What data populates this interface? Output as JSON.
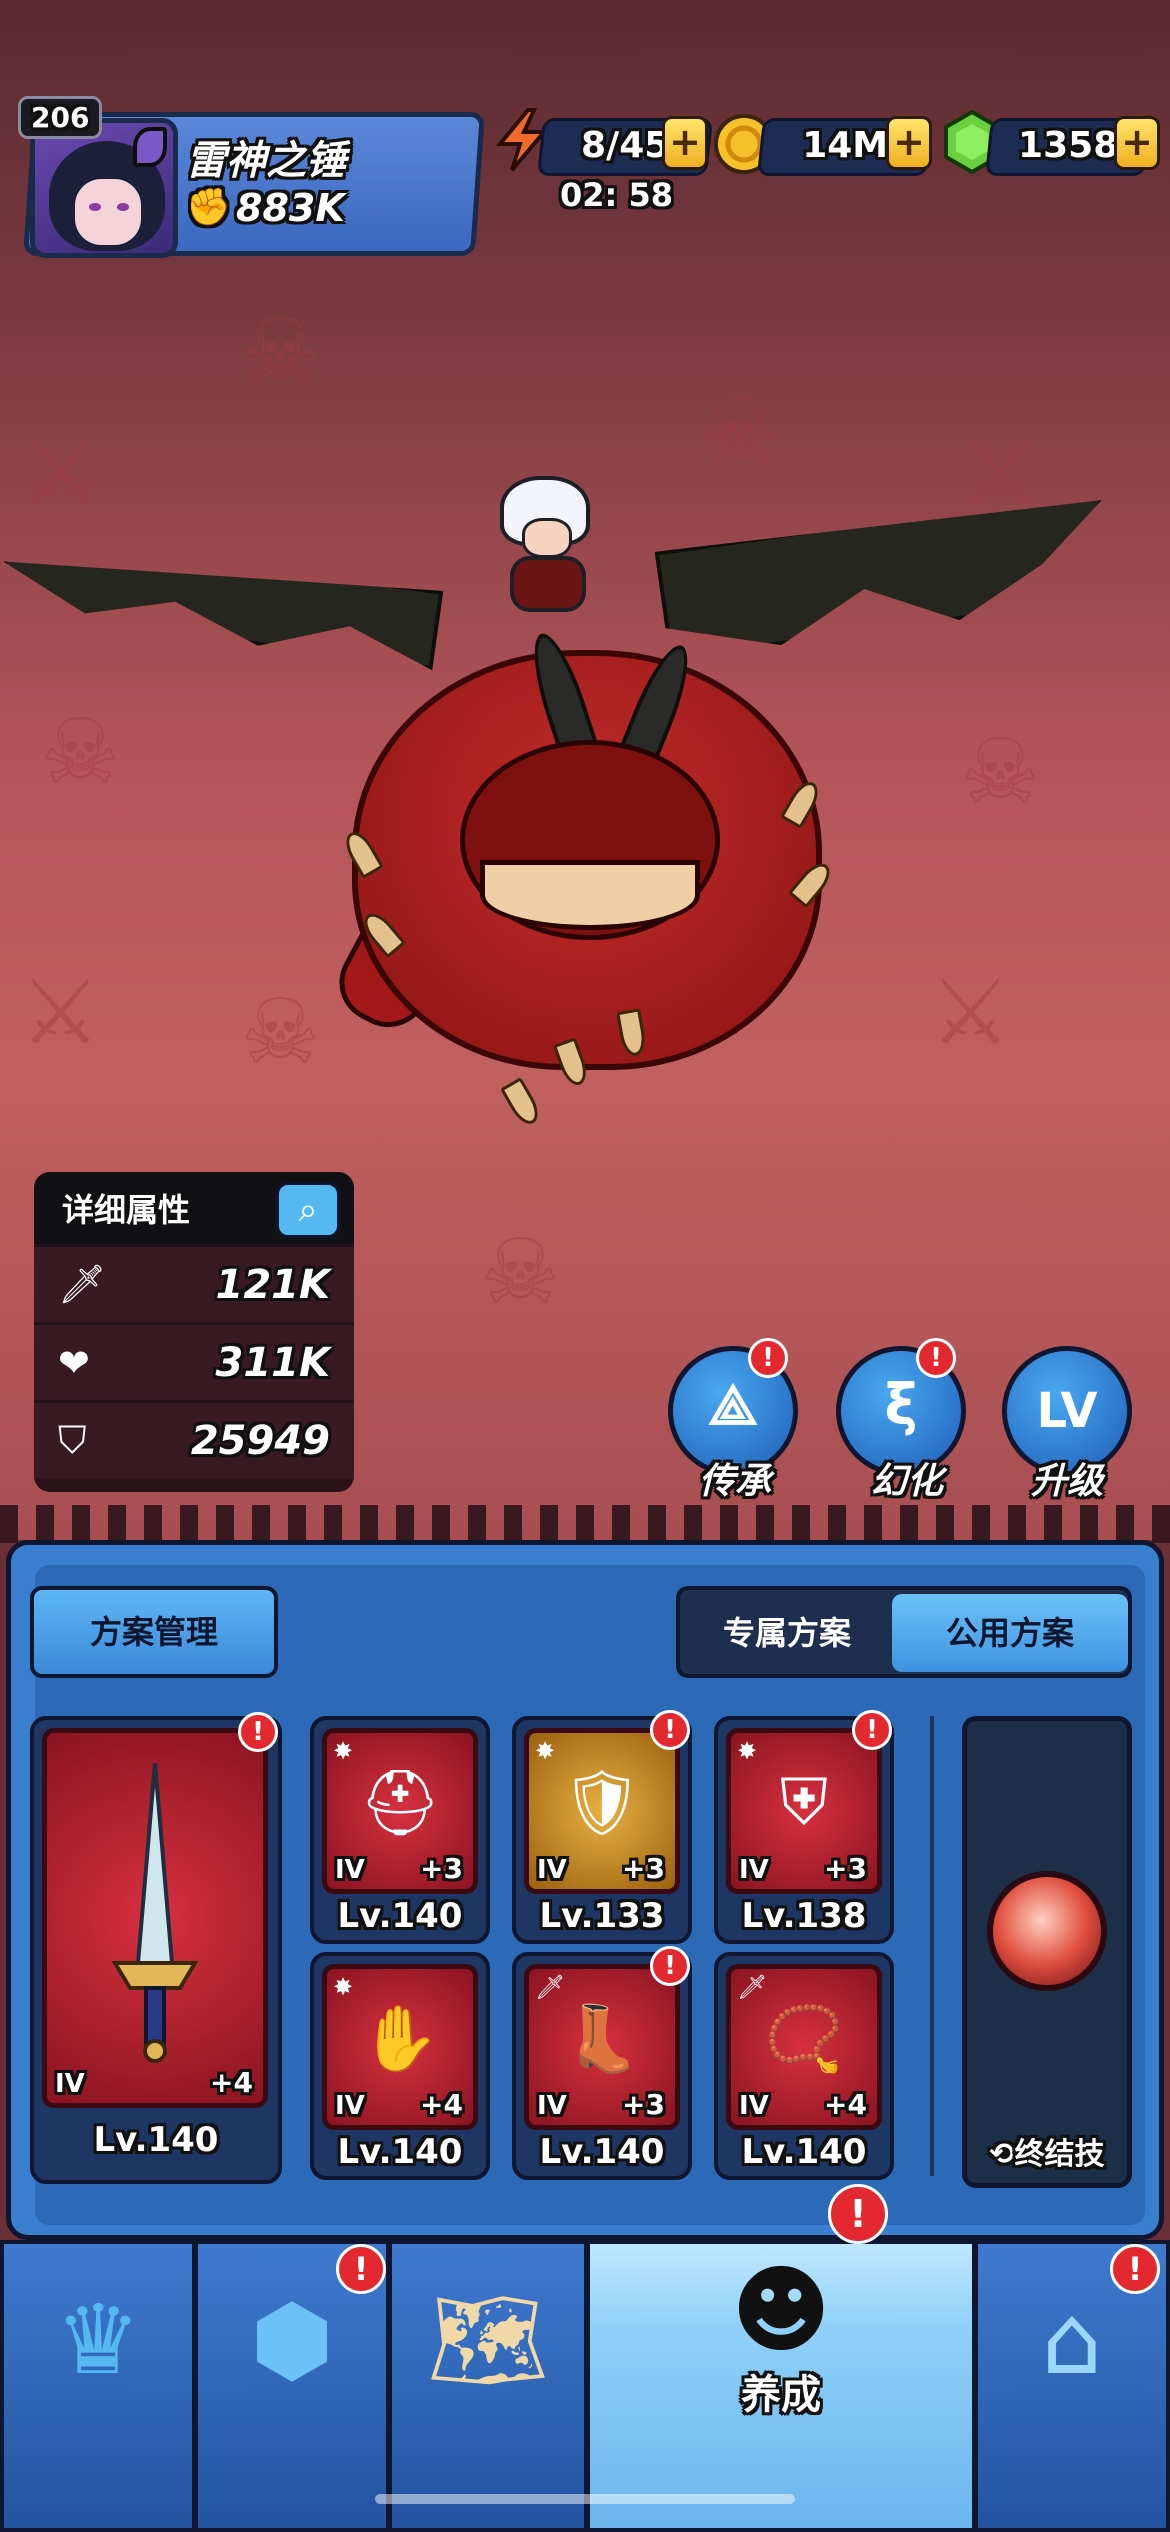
{
  "player": {
    "level": "206",
    "name": "雷神之锤",
    "power": "883K"
  },
  "resources": {
    "energy": "8/45",
    "energy_timer": "02: 58",
    "gold": "14M",
    "gems": "1358",
    "plus": "+"
  },
  "stats": {
    "title": "详细属性",
    "attack": "121K",
    "hp": "311K",
    "defense": "25949"
  },
  "actions": [
    {
      "label": "传承",
      "glyph": "⟁"
    },
    {
      "label": "幻化",
      "glyph": "ξ"
    },
    {
      "label": "升级",
      "glyph": "LV"
    }
  ],
  "alert_mark": "!",
  "panel": {
    "manage_button": "方案管理",
    "tabs": [
      {
        "label": "专属方案"
      },
      {
        "label": "公用方案"
      }
    ],
    "weapon": {
      "tier": "IV",
      "plus": "+4",
      "level": "Lv.140"
    },
    "equipment": [
      {
        "tier": "IV",
        "plus": "+3",
        "level": "Lv.140"
      },
      {
        "tier": "IV",
        "plus": "+3",
        "level": "Lv.133"
      },
      {
        "tier": "IV",
        "plus": "+3",
        "level": "Lv.138"
      },
      {
        "tier": "IV",
        "plus": "+4",
        "level": "Lv.140"
      },
      {
        "tier": "IV",
        "plus": "+3",
        "level": "Lv.140"
      },
      {
        "tier": "IV",
        "plus": "+4",
        "level": "Lv.140"
      }
    ],
    "ultimate_label": "终结技"
  },
  "nav": {
    "active_label": "养成"
  },
  "colors": {
    "accent": "#3e92e0",
    "alert": "#e4282f",
    "gold_plus": "#f0b020"
  }
}
